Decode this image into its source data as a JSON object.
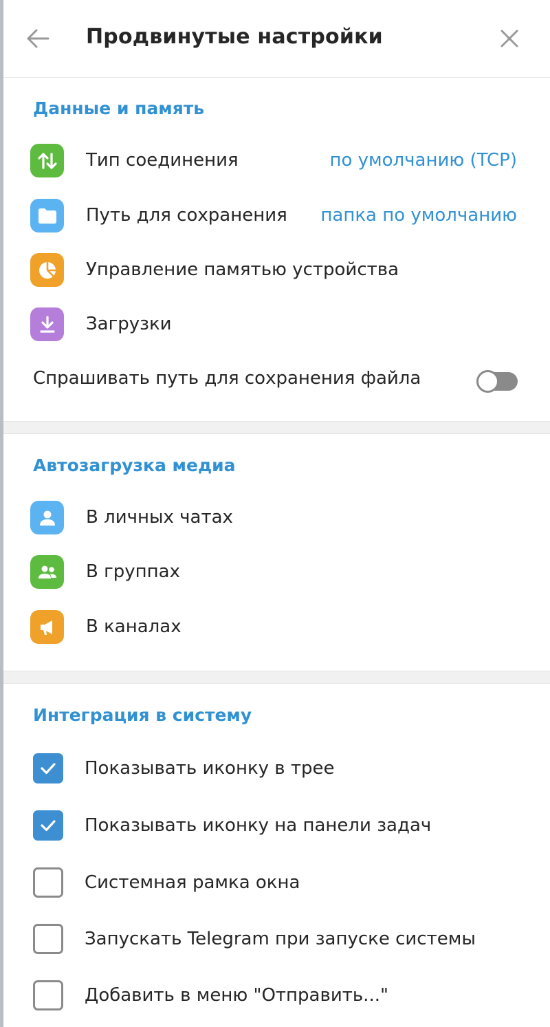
{
  "header": {
    "title": "Продвинутые настройки"
  },
  "sections": {
    "data_memory": {
      "title": "Данные и память",
      "connection": {
        "label": "Тип соединения",
        "value": "по умолчанию (TCP)",
        "icon": "arrows-up-down-icon",
        "color": "#5dbb3f"
      },
      "save_path": {
        "label": "Путь для сохранения",
        "value": "папка по умолчанию",
        "icon": "folder-icon",
        "color": "#5bb3f1"
      },
      "storage": {
        "label": "Управление памятью устройства",
        "icon": "pie-chart-icon",
        "color": "#f0a12a"
      },
      "downloads": {
        "label": "Загрузки",
        "icon": "download-icon",
        "color": "#b67edb"
      },
      "ask_path": {
        "label": "Спрашивать путь для сохранения файла",
        "enabled": false
      }
    },
    "autoload": {
      "title": "Автозагрузка медиа",
      "private": {
        "label": "В личных чатах",
        "icon": "user-icon",
        "color": "#5bb3f1"
      },
      "groups": {
        "label": "В группах",
        "icon": "group-icon",
        "color": "#5dbb3f"
      },
      "channels": {
        "label": "В каналах",
        "icon": "megaphone-icon",
        "color": "#f0a12a"
      }
    },
    "system": {
      "title": "Интеграция в систему",
      "options": [
        {
          "label": "Показывать иконку в трее",
          "checked": true
        },
        {
          "label": "Показывать иконку на панели задач",
          "checked": true
        },
        {
          "label": "Системная рамка окна",
          "checked": false
        },
        {
          "label": "Запускать Telegram при запуске системы",
          "checked": false
        },
        {
          "label": "Добавить в меню \"Отправить...\"",
          "checked": false
        }
      ]
    }
  },
  "colors": {
    "accent": "#3191d3",
    "checkbox_checked": "#3d8fd2"
  }
}
